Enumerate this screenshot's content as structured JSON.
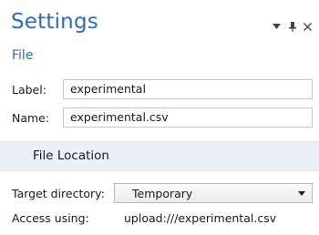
{
  "header": {
    "title": "Settings",
    "subtitle": "File"
  },
  "window_controls": {
    "menu_icon": "▾",
    "pin_icon": "⊥",
    "close_icon": "×"
  },
  "form": {
    "label_label": "Label:",
    "label_value": "experimental",
    "name_label": "Name:",
    "name_value": "experimental.csv"
  },
  "section": {
    "title": "File Location"
  },
  "location": {
    "target_label": "Target directory:",
    "target_value": "Temporary",
    "access_label": "Access using:",
    "access_value": "upload:///experimental.csv"
  },
  "colors": {
    "accent": "#2e6db4",
    "section_bg": "#eaf0f8"
  }
}
